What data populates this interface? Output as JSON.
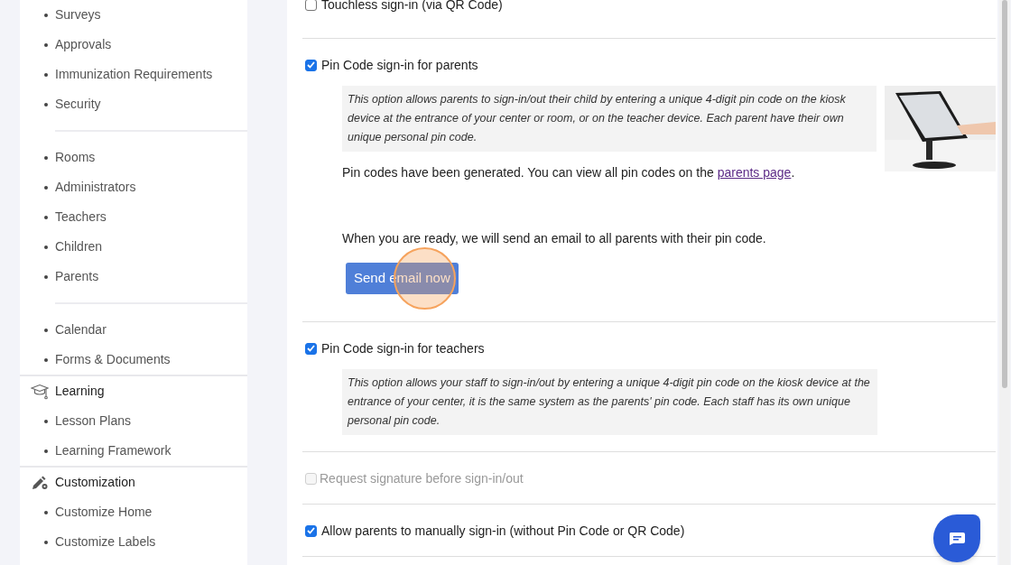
{
  "sidebar": {
    "sections": [
      {
        "groups": [
          [
            "Surveys",
            "Approvals",
            "Immunization Requirements",
            "Security"
          ],
          [
            "Rooms",
            "Administrators",
            "Teachers",
            "Children",
            "Parents"
          ],
          [
            "Calendar",
            "Forms & Documents"
          ]
        ]
      },
      {
        "heading": "Learning",
        "groups": [
          [
            "Lesson Plans",
            "Learning Framework"
          ]
        ]
      },
      {
        "heading": "Customization",
        "groups": [
          [
            "Customize Home",
            "Customize Labels"
          ]
        ]
      }
    ]
  },
  "settings": [
    {
      "label": "Touchless sign-in (via QR Code)",
      "checked": false,
      "disabled": false
    },
    {
      "label": "Pin Code sign-in for parents",
      "checked": true,
      "disabled": false,
      "description": "This option allows parents to sign-in/out their child by entering a unique 4-digit pin code on the kiosk device at the entrance of your center or room, or on the teacher device. Each parent have their own unique personal pin code.",
      "image": {
        "kind": "picture"
      },
      "notes": [
        {
          "text": "Pin codes have been generated. You can view all pin codes on the ",
          "link": "parents page",
          "suffix": "."
        },
        {
          "text": "When you are ready, we will send an email to all parents with their pin code."
        }
      ],
      "button": "Send email now"
    },
    {
      "label": "Pin Code sign-in for teachers",
      "checked": true,
      "disabled": false,
      "description": "This option allows your staff to sign-in/out by entering a unique 4-digit pin code on the kiosk device at the entrance of your center, it is the same system as the parents' pin code. Each staff has its own unique personal pin code."
    },
    {
      "label": "Request signature before sign-in/out",
      "checked": false,
      "disabled": true
    },
    {
      "label": "Allow parents to manually sign-in (without Pin Code or QR Code)",
      "checked": true,
      "disabled": false
    }
  ]
}
